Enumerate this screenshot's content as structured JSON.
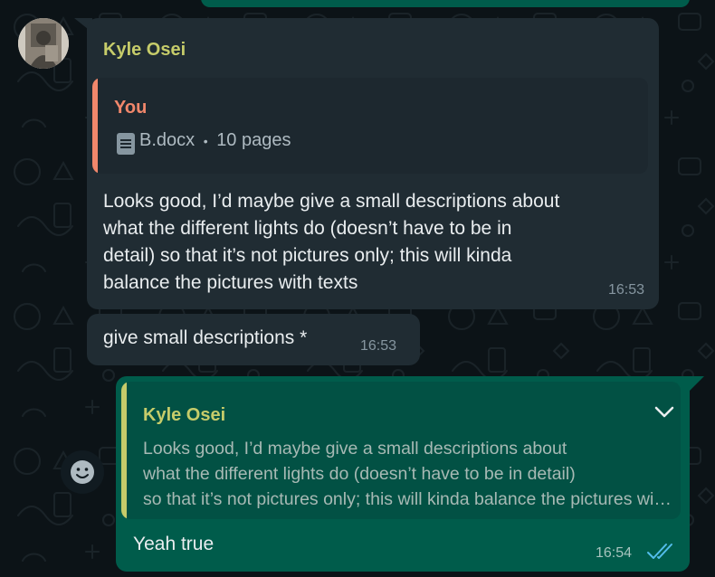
{
  "colors": {
    "background": "#0c1317",
    "incoming_bubble": "#202c33",
    "outgoing_bubble": "#005c4b",
    "sender_name": "#c6cc6a",
    "you_quote_accent": "#f1876b",
    "read_ticks": "#53bdeb"
  },
  "message_1": {
    "sender": "Kyle Osei",
    "quoted": {
      "author": "You",
      "icon": "document-icon",
      "file_name": "B.docx",
      "separator": "•",
      "pages": "10 pages"
    },
    "text_lines": [
      "Looks good, I’d maybe give a small descriptions about",
      "what the different lights do (doesn’t have to be in",
      "detail) so that it’s not pictures only; this will kinda",
      "balance the pictures with texts"
    ],
    "time": "16:53"
  },
  "message_2": {
    "text": "give small descriptions *",
    "time": "16:53"
  },
  "message_3": {
    "quoted": {
      "author": "Kyle Osei",
      "lines": [
        "Looks good, I’d maybe give a small descriptions about",
        "what the different lights do (doesn’t have to be in detail)",
        "so that it’s not pictures only; this will kinda balance the pictures with texts"
      ]
    },
    "text": "Yeah true",
    "time": "16:54",
    "status_icon": "double-check-icon"
  },
  "emoji_button_icon": "smiley-icon"
}
